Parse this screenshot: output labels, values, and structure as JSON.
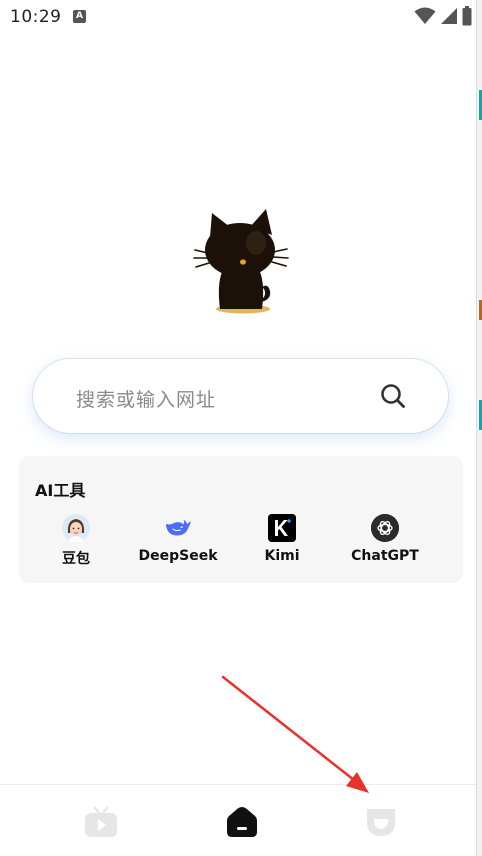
{
  "status_bar": {
    "time": "10:29",
    "app_badge": "A"
  },
  "search": {
    "placeholder": "搜索或输入网址"
  },
  "ai_tools": {
    "title": "AI工具",
    "items": [
      {
        "label": "豆包",
        "icon": "doubao-avatar-icon"
      },
      {
        "label": "DeepSeek",
        "icon": "deepseek-whale-icon"
      },
      {
        "label": "Kimi",
        "icon": "kimi-k-icon"
      },
      {
        "label": "ChatGPT",
        "icon": "chatgpt-logo-icon"
      }
    ]
  },
  "bottom_nav": {
    "items": [
      "video-tab-icon",
      "home-tab-icon",
      "profile-tab-icon"
    ],
    "active": "home-tab-icon"
  },
  "colors": {
    "accent_red": "#e8322b",
    "deepseek_blue": "#4d6bfe",
    "search_shadow": "#78aae6"
  }
}
